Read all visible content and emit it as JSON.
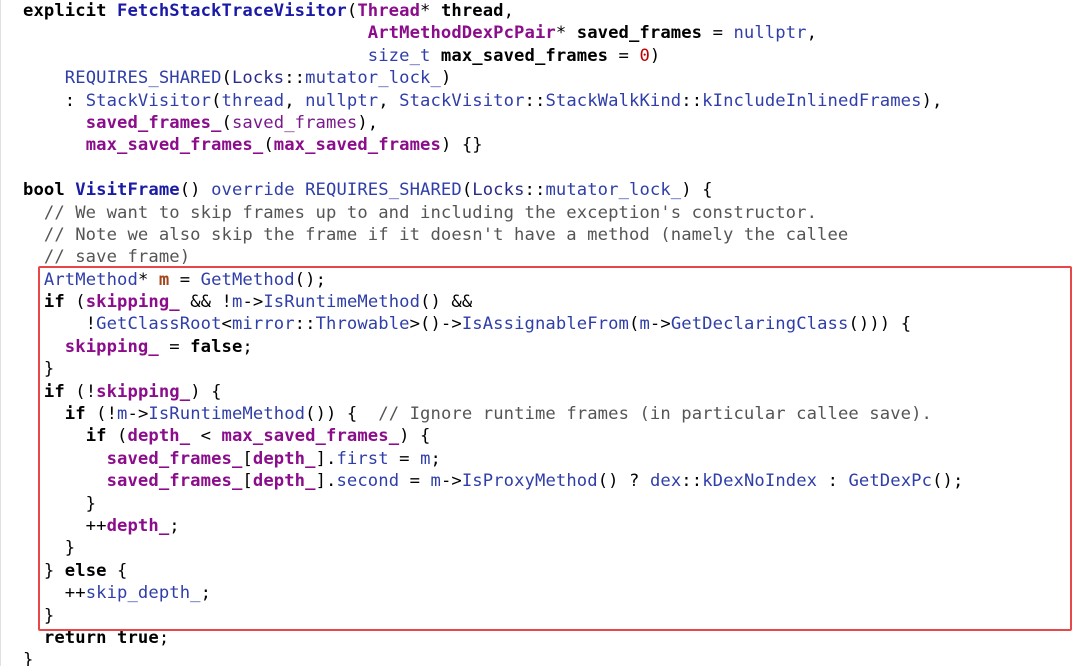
{
  "editor": {
    "highlight_color": "#e8474a",
    "lines": [
      [
        [
          "kw",
          "explicit "
        ],
        [
          "fnb",
          "FetchStackTraceVisitor"
        ],
        [
          "plain",
          "("
        ],
        [
          "purpleb",
          "Thread"
        ],
        [
          "plain",
          "* "
        ],
        [
          "kw",
          "thread"
        ],
        [
          "plain",
          ","
        ]
      ],
      [
        [
          "plain",
          "                                 "
        ],
        [
          "purpleb",
          "ArtMethodDexPcPair"
        ],
        [
          "plain",
          "* "
        ],
        [
          "kw",
          "saved_frames"
        ],
        [
          "plain",
          " = "
        ],
        [
          "blue",
          "nullptr"
        ],
        [
          "plain",
          ","
        ]
      ],
      [
        [
          "plain",
          "                                 "
        ],
        [
          "blue",
          "size_t "
        ],
        [
          "kw",
          "max_saved_frames"
        ],
        [
          "plain",
          " = "
        ],
        [
          "num",
          "0"
        ],
        [
          "plain",
          ")"
        ]
      ],
      [
        [
          "plain",
          "    "
        ],
        [
          "blue",
          "REQUIRES_SHARED"
        ],
        [
          "plain",
          "("
        ],
        [
          "type",
          "Locks"
        ],
        [
          "plain",
          "::"
        ],
        [
          "blue",
          "mutator_lock_"
        ],
        [
          "plain",
          ")"
        ]
      ],
      [
        [
          "plain",
          "    : "
        ],
        [
          "blue",
          "StackVisitor"
        ],
        [
          "plain",
          "("
        ],
        [
          "blue",
          "thread"
        ],
        [
          "plain",
          ", "
        ],
        [
          "blue",
          "nullptr"
        ],
        [
          "plain",
          ", "
        ],
        [
          "blue",
          "StackVisitor"
        ],
        [
          "plain",
          "::"
        ],
        [
          "blue",
          "StackWalkKind"
        ],
        [
          "plain",
          "::"
        ],
        [
          "blue",
          "kIncludeInlinedFrames"
        ],
        [
          "plain",
          "),"
        ]
      ],
      [
        [
          "plain",
          "      "
        ],
        [
          "purpleb",
          "saved_frames_"
        ],
        [
          "plain",
          "("
        ],
        [
          "purple",
          "saved_frames"
        ],
        [
          "plain",
          "),"
        ]
      ],
      [
        [
          "plain",
          "      "
        ],
        [
          "purpleb",
          "max_saved_frames_"
        ],
        [
          "plain",
          "("
        ],
        [
          "purpleb",
          "max_saved_frames"
        ],
        [
          "plain",
          ") {}"
        ]
      ],
      [
        [
          "plain",
          ""
        ]
      ],
      [
        [
          "kw",
          "bool "
        ],
        [
          "fnb",
          "VisitFrame"
        ],
        [
          "plain",
          "() "
        ],
        [
          "blue",
          "override "
        ],
        [
          "blue",
          "REQUIRES_SHARED"
        ],
        [
          "plain",
          "("
        ],
        [
          "type",
          "Locks"
        ],
        [
          "plain",
          "::"
        ],
        [
          "blue",
          "mutator_lock_"
        ],
        [
          "plain",
          ") {"
        ]
      ],
      [
        [
          "comment",
          "  // We want to skip frames up to and including the exception's constructor."
        ]
      ],
      [
        [
          "comment",
          "  // Note we also skip the frame if it doesn't have a method (namely the callee"
        ]
      ],
      [
        [
          "comment",
          "  // save frame)"
        ]
      ],
      [
        [
          "plain",
          "  "
        ],
        [
          "blue",
          "ArtMethod"
        ],
        [
          "plain",
          "* "
        ],
        [
          "brown",
          "m"
        ],
        [
          "plain",
          " = "
        ],
        [
          "blue",
          "GetMethod"
        ],
        [
          "plain",
          "();"
        ]
      ],
      [
        [
          "plain",
          "  "
        ],
        [
          "kw",
          "if"
        ],
        [
          "plain",
          " ("
        ],
        [
          "purpleb",
          "skipping_"
        ],
        [
          "plain",
          " && !"
        ],
        [
          "blue",
          "m"
        ],
        [
          "plain",
          "->"
        ],
        [
          "blue",
          "IsRuntimeMethod"
        ],
        [
          "plain",
          "() &&"
        ]
      ],
      [
        [
          "plain",
          "      !"
        ],
        [
          "blue",
          "GetClassRoot"
        ],
        [
          "plain",
          "<"
        ],
        [
          "blue",
          "mirror"
        ],
        [
          "plain",
          "::"
        ],
        [
          "blue",
          "Throwable"
        ],
        [
          "plain",
          ">()->"
        ],
        [
          "blue",
          "IsAssignableFrom"
        ],
        [
          "plain",
          "("
        ],
        [
          "blue",
          "m"
        ],
        [
          "plain",
          "->"
        ],
        [
          "blue",
          "GetDeclaringClass"
        ],
        [
          "plain",
          "())) {"
        ]
      ],
      [
        [
          "plain",
          "    "
        ],
        [
          "purpleb",
          "skipping_"
        ],
        [
          "plain",
          " = "
        ],
        [
          "kw",
          "false"
        ],
        [
          "plain",
          ";"
        ]
      ],
      [
        [
          "plain",
          "  }"
        ]
      ],
      [
        [
          "plain",
          "  "
        ],
        [
          "kw",
          "if"
        ],
        [
          "plain",
          " (!"
        ],
        [
          "purpleb",
          "skipping_"
        ],
        [
          "plain",
          ") {"
        ]
      ],
      [
        [
          "plain",
          "    "
        ],
        [
          "kw",
          "if"
        ],
        [
          "plain",
          " (!"
        ],
        [
          "blue",
          "m"
        ],
        [
          "plain",
          "->"
        ],
        [
          "blue",
          "IsRuntimeMethod"
        ],
        [
          "plain",
          "()) {  "
        ],
        [
          "comment",
          "// Ignore runtime frames (in particular callee save)."
        ]
      ],
      [
        [
          "plain",
          "      "
        ],
        [
          "kw",
          "if"
        ],
        [
          "plain",
          " ("
        ],
        [
          "purpleb",
          "depth_"
        ],
        [
          "plain",
          " < "
        ],
        [
          "purpleb",
          "max_saved_frames_"
        ],
        [
          "plain",
          ") {"
        ]
      ],
      [
        [
          "plain",
          "        "
        ],
        [
          "purpleb",
          "saved_frames_"
        ],
        [
          "plain",
          "["
        ],
        [
          "purpleb",
          "depth_"
        ],
        [
          "plain",
          "]."
        ],
        [
          "blue",
          "first"
        ],
        [
          "plain",
          " = "
        ],
        [
          "blue",
          "m"
        ],
        [
          "plain",
          ";"
        ]
      ],
      [
        [
          "plain",
          "        "
        ],
        [
          "purpleb",
          "saved_frames_"
        ],
        [
          "plain",
          "["
        ],
        [
          "purpleb",
          "depth_"
        ],
        [
          "plain",
          "]."
        ],
        [
          "blue",
          "second"
        ],
        [
          "plain",
          " = "
        ],
        [
          "blue",
          "m"
        ],
        [
          "plain",
          "->"
        ],
        [
          "blue",
          "IsProxyMethod"
        ],
        [
          "plain",
          "() ? "
        ],
        [
          "blue",
          "dex"
        ],
        [
          "plain",
          "::"
        ],
        [
          "blue",
          "kDexNoIndex"
        ],
        [
          "plain",
          " : "
        ],
        [
          "blue",
          "GetDexPc"
        ],
        [
          "plain",
          "();"
        ]
      ],
      [
        [
          "plain",
          "      }"
        ]
      ],
      [
        [
          "plain",
          "      ++"
        ],
        [
          "purpleb",
          "depth_"
        ],
        [
          "plain",
          ";"
        ]
      ],
      [
        [
          "plain",
          "    }"
        ]
      ],
      [
        [
          "plain",
          "  } "
        ],
        [
          "kw",
          "else"
        ],
        [
          "plain",
          " {"
        ]
      ],
      [
        [
          "plain",
          "    ++"
        ],
        [
          "blue",
          "skip_depth_"
        ],
        [
          "plain",
          ";"
        ]
      ],
      [
        [
          "plain",
          "  }"
        ]
      ],
      [
        [
          "plain",
          "  "
        ],
        [
          "kw",
          "return true"
        ],
        [
          "plain",
          ";"
        ]
      ],
      [
        [
          "plain",
          "}"
        ]
      ]
    ]
  }
}
